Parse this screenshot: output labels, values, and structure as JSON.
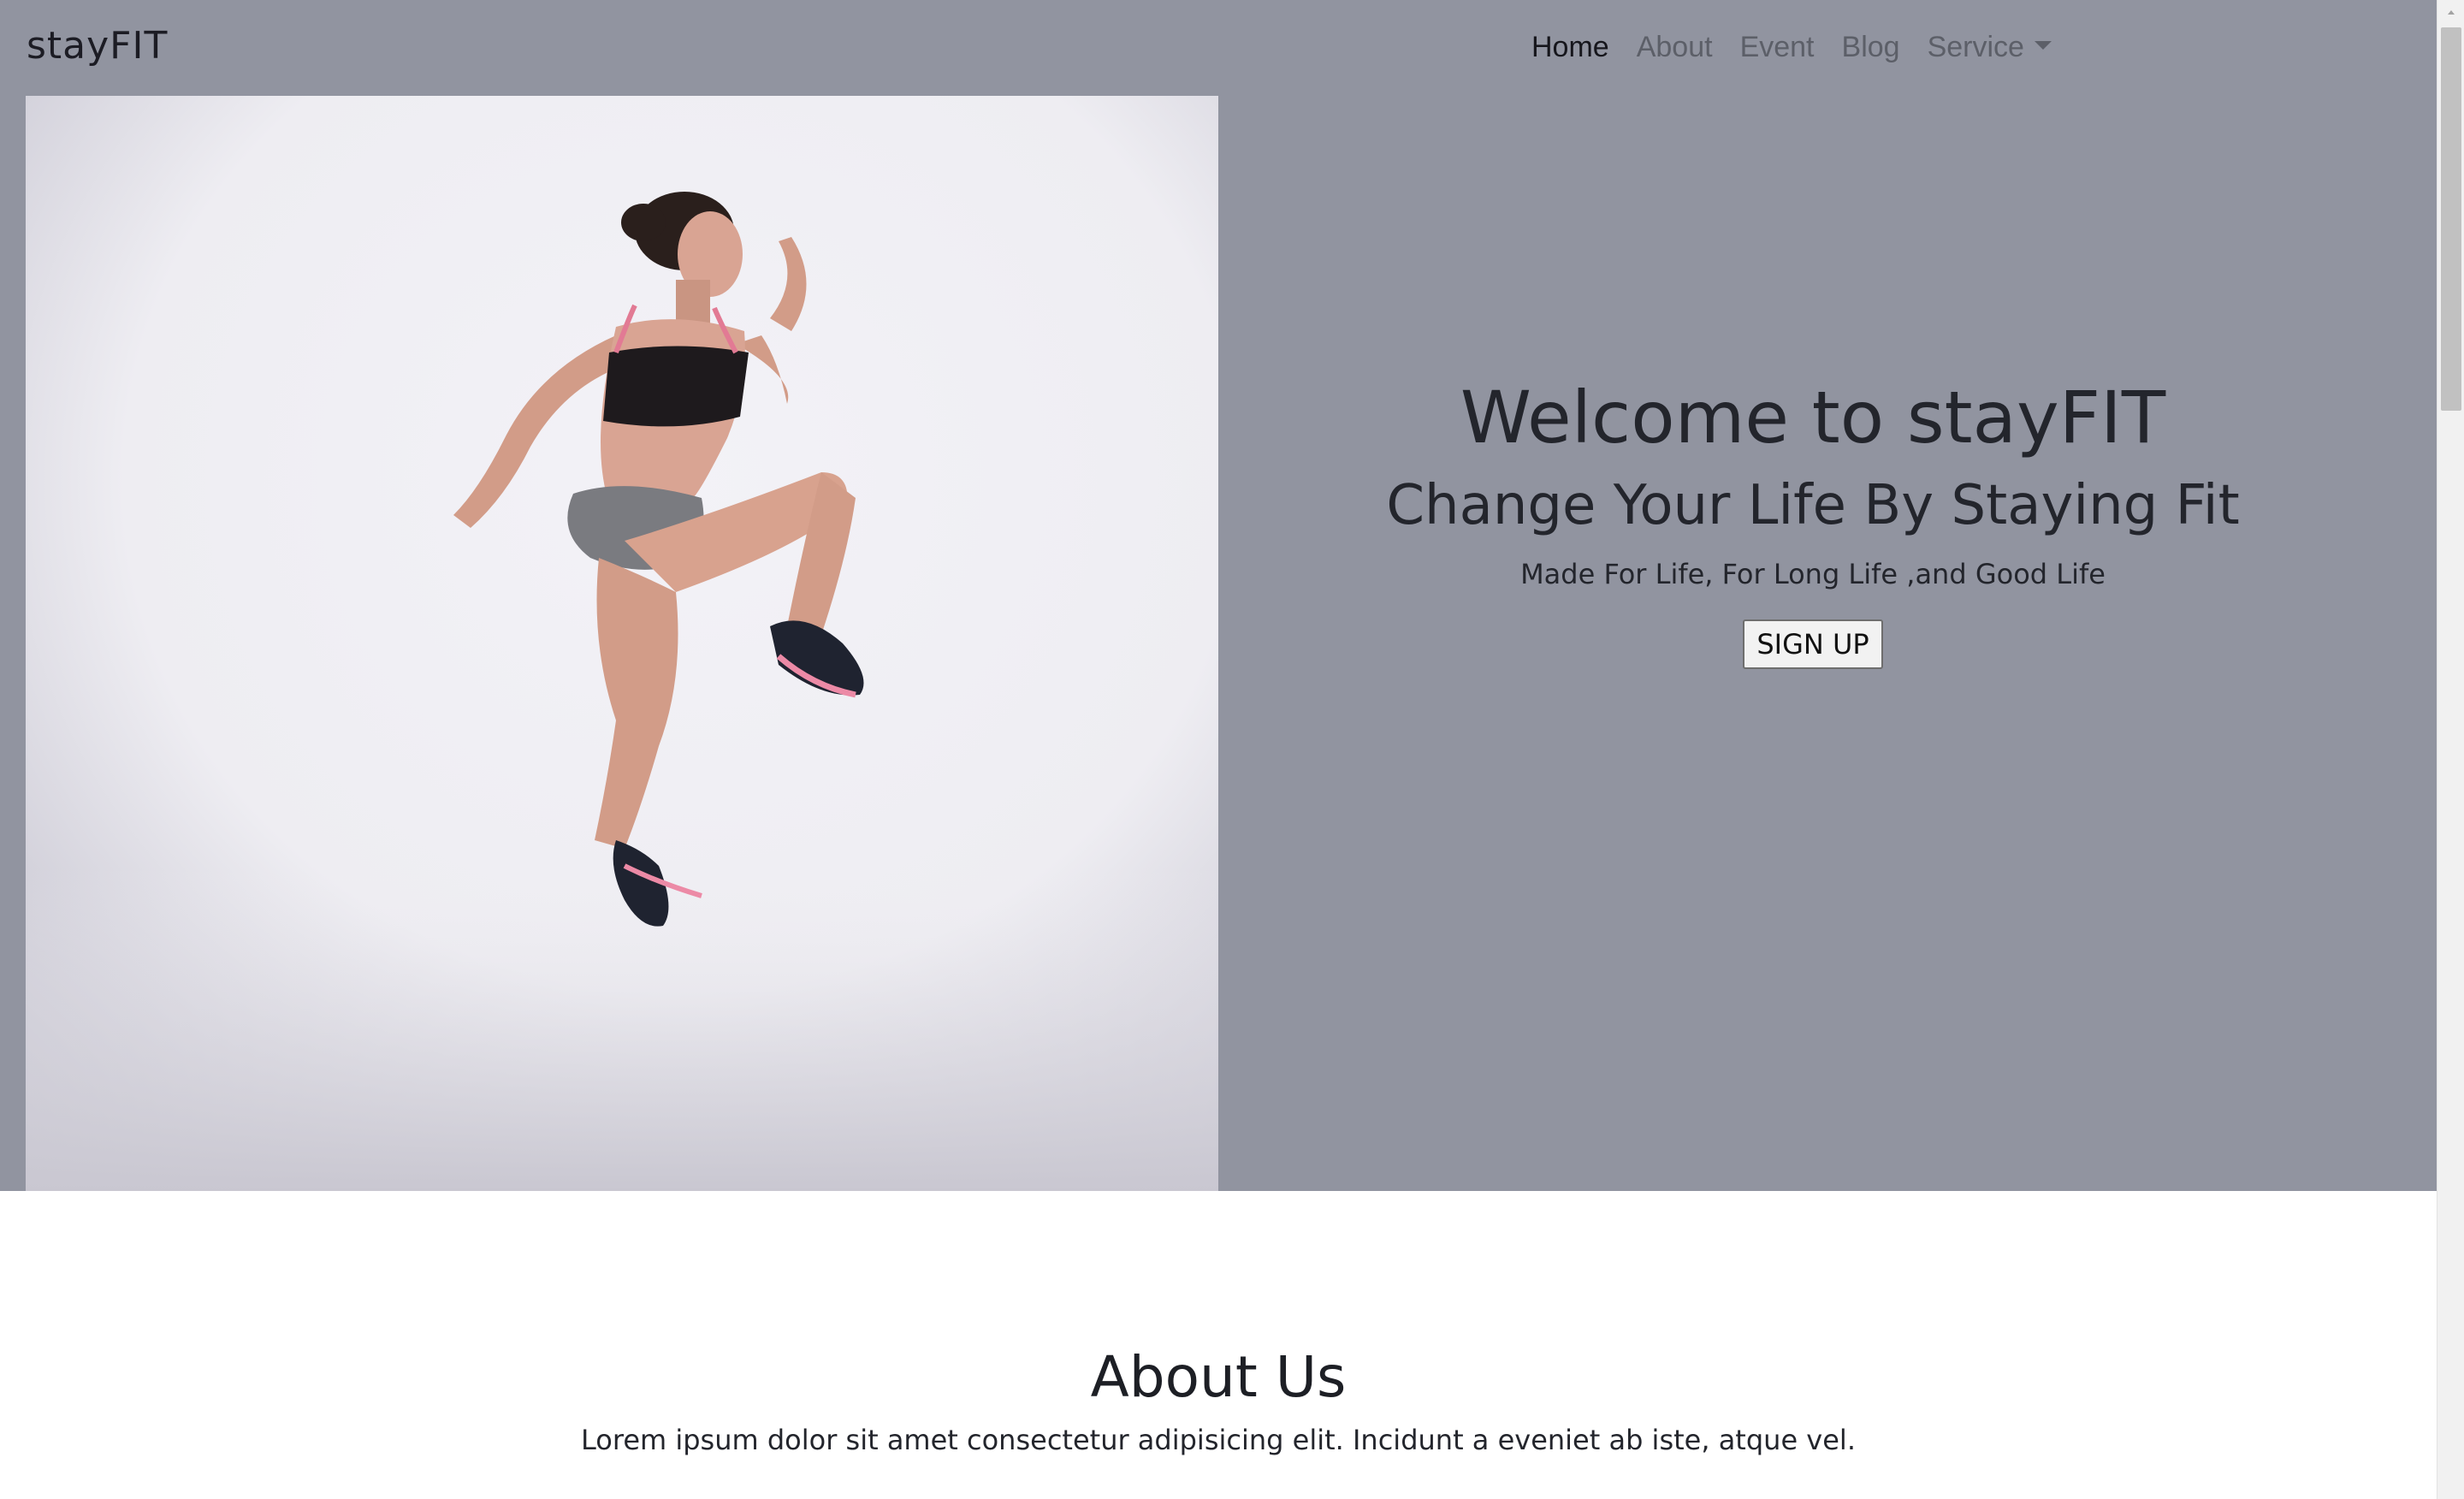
{
  "brand": {
    "name": "stayFIT"
  },
  "nav": {
    "items": [
      {
        "label": "Home"
      },
      {
        "label": "About"
      },
      {
        "label": "Event"
      },
      {
        "label": "Blog"
      },
      {
        "label": "Service"
      }
    ]
  },
  "hero": {
    "title": "Welcome to stayFIT",
    "subtitle": "Change Your Life By Staying Fit",
    "tagline": "Made For Life, For Long Life ,and Good Life",
    "signup_label": "SIGN UP",
    "image_alt": "woman jumping in athletic wear",
    "background_color": "#9194a0"
  },
  "about": {
    "title": "About Us",
    "text": "Lorem ipsum dolor sit amet consectetur adipisicing elit. Incidunt a eveniet ab iste, atque vel."
  },
  "icons": {
    "dropdown": "chevron-down-icon",
    "scroll_up": "arrow-up-icon"
  }
}
